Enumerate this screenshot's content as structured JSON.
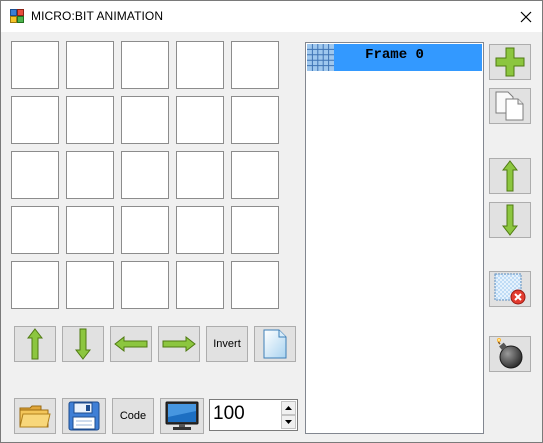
{
  "window": {
    "title": "MICRO:BIT ANIMATION",
    "icon": "app-icon",
    "close_icon": "close-icon"
  },
  "led_grid": {
    "rows": 5,
    "cols": 5,
    "lit": []
  },
  "shift_toolbar": {
    "up_icon": "arrow-up-icon",
    "down_icon": "arrow-down-icon",
    "left_icon": "arrow-left-icon",
    "right_icon": "arrow-right-icon",
    "invert_label": "Invert",
    "clear_icon": "document-icon"
  },
  "bottom_toolbar": {
    "open_icon": "folder-icon",
    "save_icon": "floppy-icon",
    "code_label": "Code",
    "preview_icon": "monitor-icon",
    "delay_value": "100"
  },
  "frames": {
    "items": [
      {
        "label": "Frame 0",
        "selected": true
      }
    ]
  },
  "frame_toolbar": {
    "add_icon": "plus-icon",
    "duplicate_icon": "copy-icon",
    "move_up_icon": "arrow-up-icon",
    "move_down_icon": "arrow-down-icon",
    "delete_icon": "delete-frame-icon",
    "clear_all_icon": "bomb-icon"
  },
  "colors": {
    "selection": "#3399ff",
    "arrow_green": "#7ab800",
    "button_face": "#e1e1e1",
    "window_bg": "#f0f0f0"
  }
}
